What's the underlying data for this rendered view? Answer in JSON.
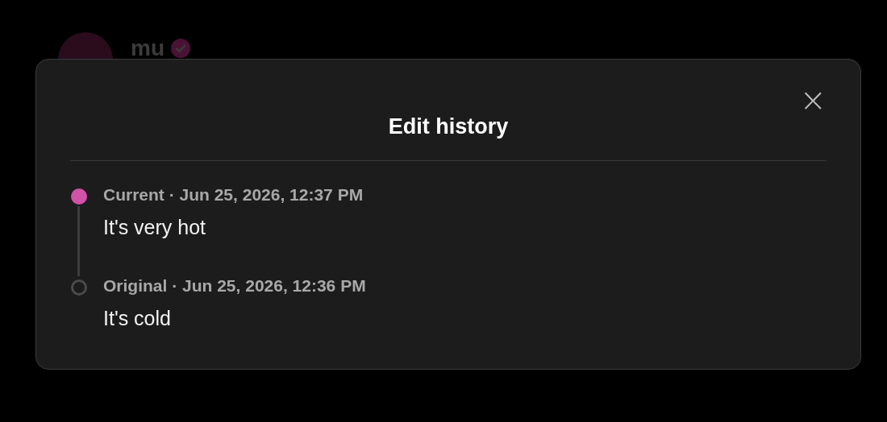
{
  "background": {
    "author": {
      "name": "mu",
      "verified": true
    }
  },
  "dialog": {
    "title": "Edit history",
    "close": "×",
    "entries": [
      {
        "kind": "current",
        "meta": "Current · Jun 25, 2026, 12:37 PM",
        "text": "It's very hot"
      },
      {
        "kind": "original",
        "meta": "Original · Jun 25, 2026, 12:36 PM",
        "text": "It's cold"
      }
    ]
  }
}
